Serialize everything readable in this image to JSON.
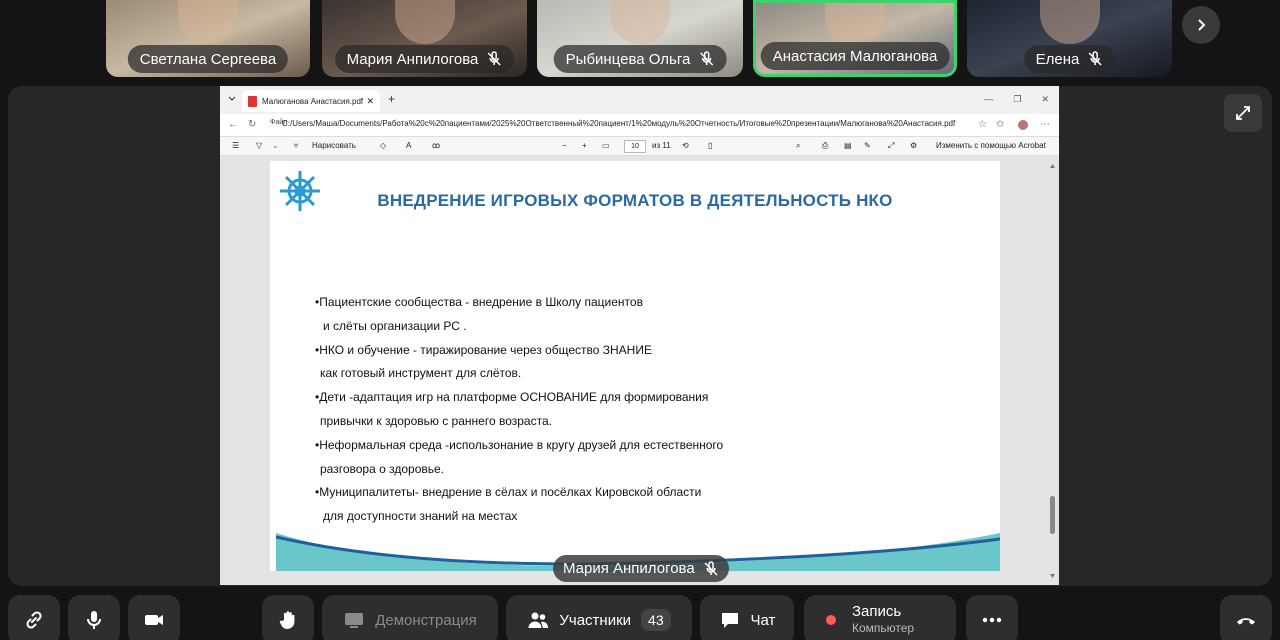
{
  "participants": [
    {
      "name": "Светлана Сергеева",
      "muted": false
    },
    {
      "name": "Мария Анпилогова",
      "muted": true
    },
    {
      "name": "Рыбинцева Ольга",
      "muted": true
    },
    {
      "name": "Анастасия Малюганова",
      "muted": false,
      "active_speaker": true
    },
    {
      "name": "Елена",
      "muted": true
    }
  ],
  "browser": {
    "tab_title": "Малюганова Анастасия.pdf",
    "address_label": "Файл",
    "url": "C:/Users/Маша/Documents/Работа%20с%20пациентами/2025%20Ответственный%20пациент/1%20модуль%20Отчетность/Итоговые%20презентации/Малюганова%20Анастасия.pdf",
    "toolbar": {
      "draw_label": "Нарисовать",
      "page_current": "10",
      "page_of": "из 11",
      "zoom_minus": "−",
      "zoom_plus": "+",
      "edit_label": "Изменить с помощью Acrobat"
    }
  },
  "slide": {
    "title": "ВНЕДРЕНИЕ ИГРОВЫХ ФОРМАТОВ В ДЕЯТЕЛЬНОСТЬ НКО",
    "lines": [
      "•Пациентские сообщества - внедрение в Школу пациентов",
      "  и слёты организации РС .",
      "•НКО и обучение - тиражирование через общество ЗНАНИЕ",
      "  как готовый инструмент для слётов.",
      "•Дети -адаптация игр на платформе ОСНОВАНИЕ для формирования",
      "  привычки к здоровью с раннего возраста.",
      "•Неформальная среда -использонание в кругу друзей для естественного",
      "  разговора о здоровье.",
      "•Муниципалитеты- внедрение в сёлах и посёлках Кировской области",
      "  для доступности знаний на местах"
    ],
    "accent_color": "#2a6aa3"
  },
  "speaker_label": "Мария Анпилогова",
  "controls": {
    "demo_label": "Демонстрация",
    "participants_label": "Участники",
    "participants_count": "43",
    "chat_label": "Чат",
    "record_label": "Запись",
    "record_sub": "Компьютер"
  },
  "colors": {
    "active_border": "#3fd16b",
    "record_dot": "#ff5b5b",
    "background": "#141414"
  }
}
